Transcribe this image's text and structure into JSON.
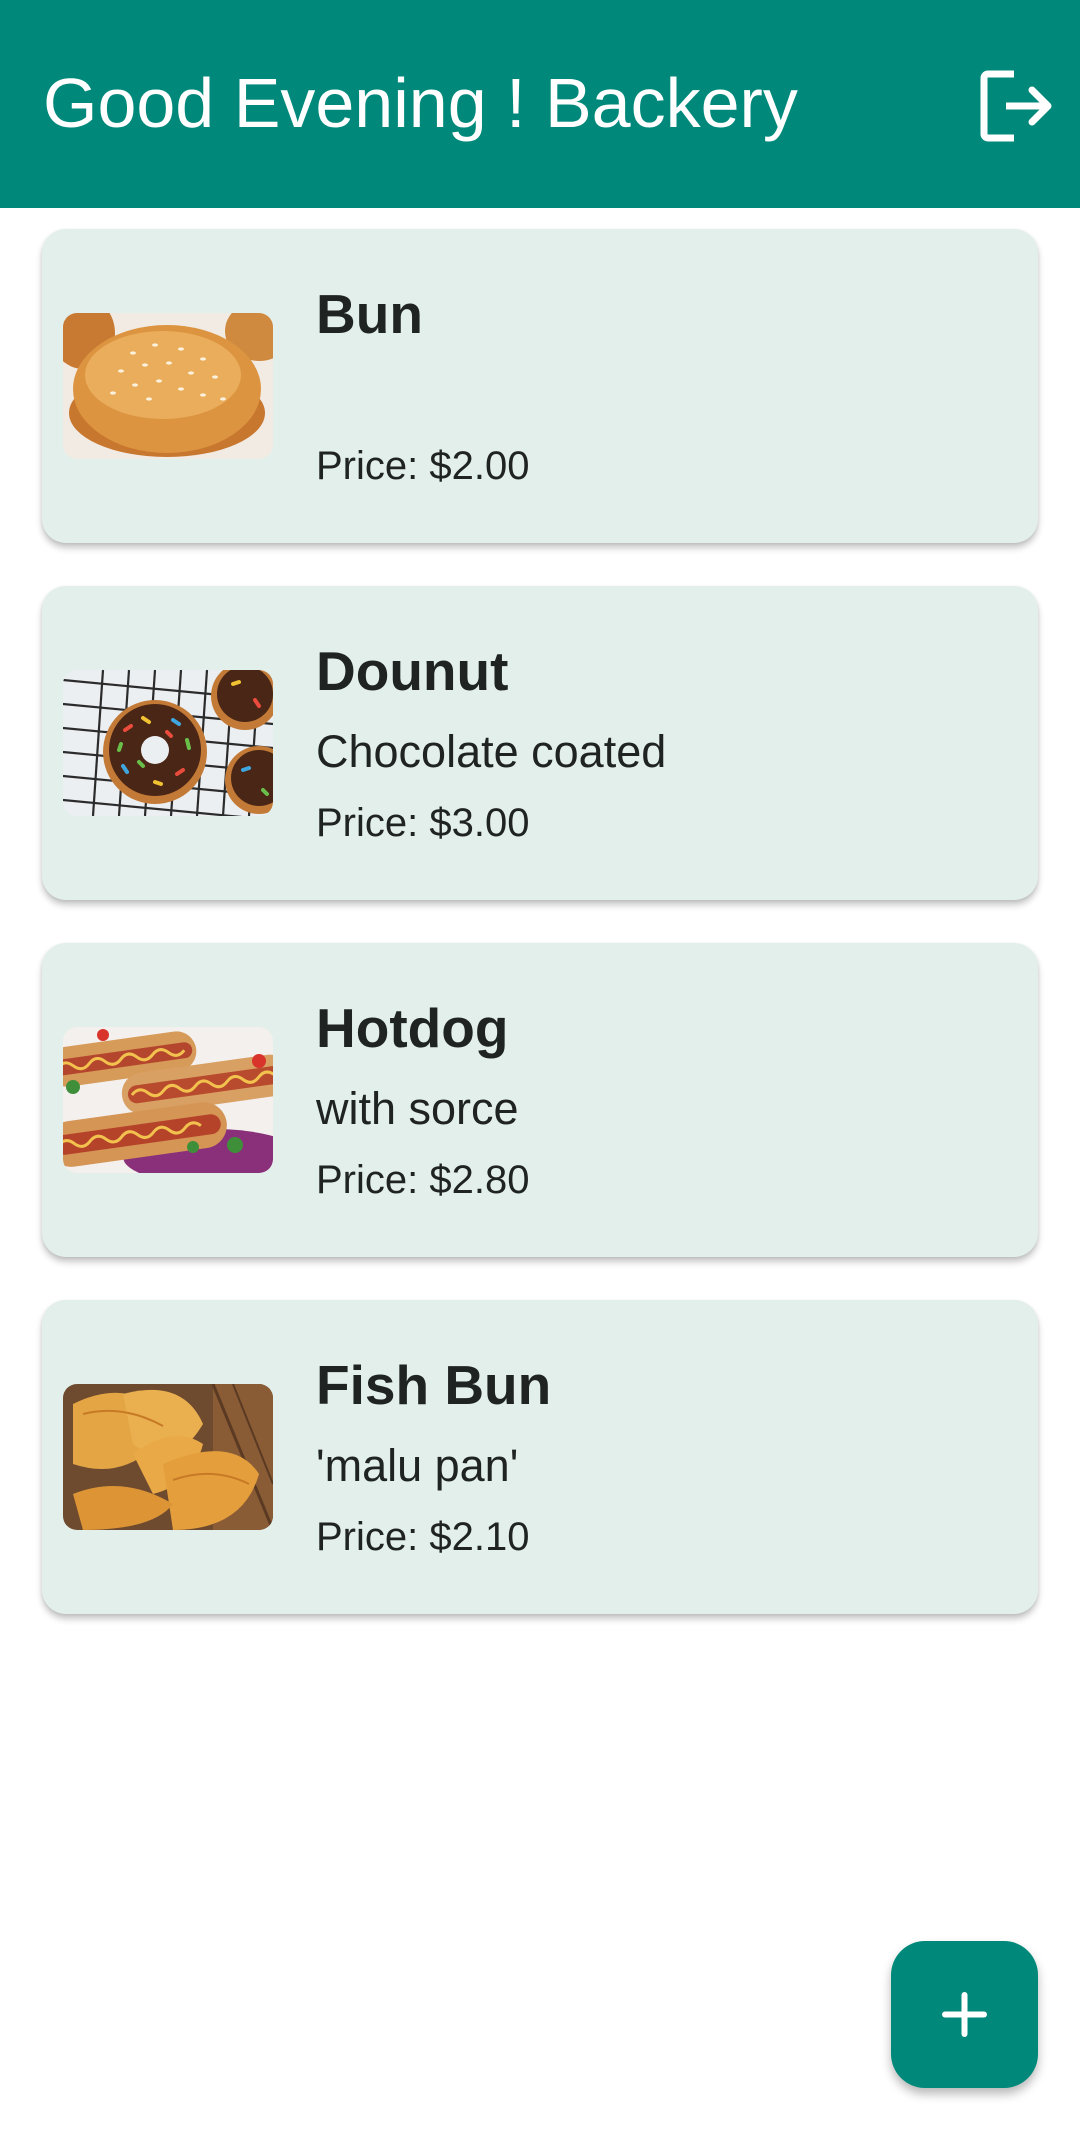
{
  "app_bar": {
    "title": "Good Evening ! Backery",
    "logout_icon": "logout-icon",
    "color": "#00897b"
  },
  "items": [
    {
      "name": "Bun",
      "description": "",
      "price": "Price: $2.00",
      "image": "bun-image"
    },
    {
      "name": "Dounut",
      "description": "Chocolate coated",
      "price": "Price: $3.00",
      "image": "donut-image"
    },
    {
      "name": "Hotdog",
      "description": "with sorce",
      "price": "Price: $2.80",
      "image": "hotdog-image"
    },
    {
      "name": "Fish Bun",
      "description": "'malu pan'",
      "price": "Price: $2.10",
      "image": "fish-bun-image"
    }
  ],
  "fab": {
    "icon": "plus-icon",
    "color": "#00897b"
  },
  "card_color": "#e2efeb"
}
